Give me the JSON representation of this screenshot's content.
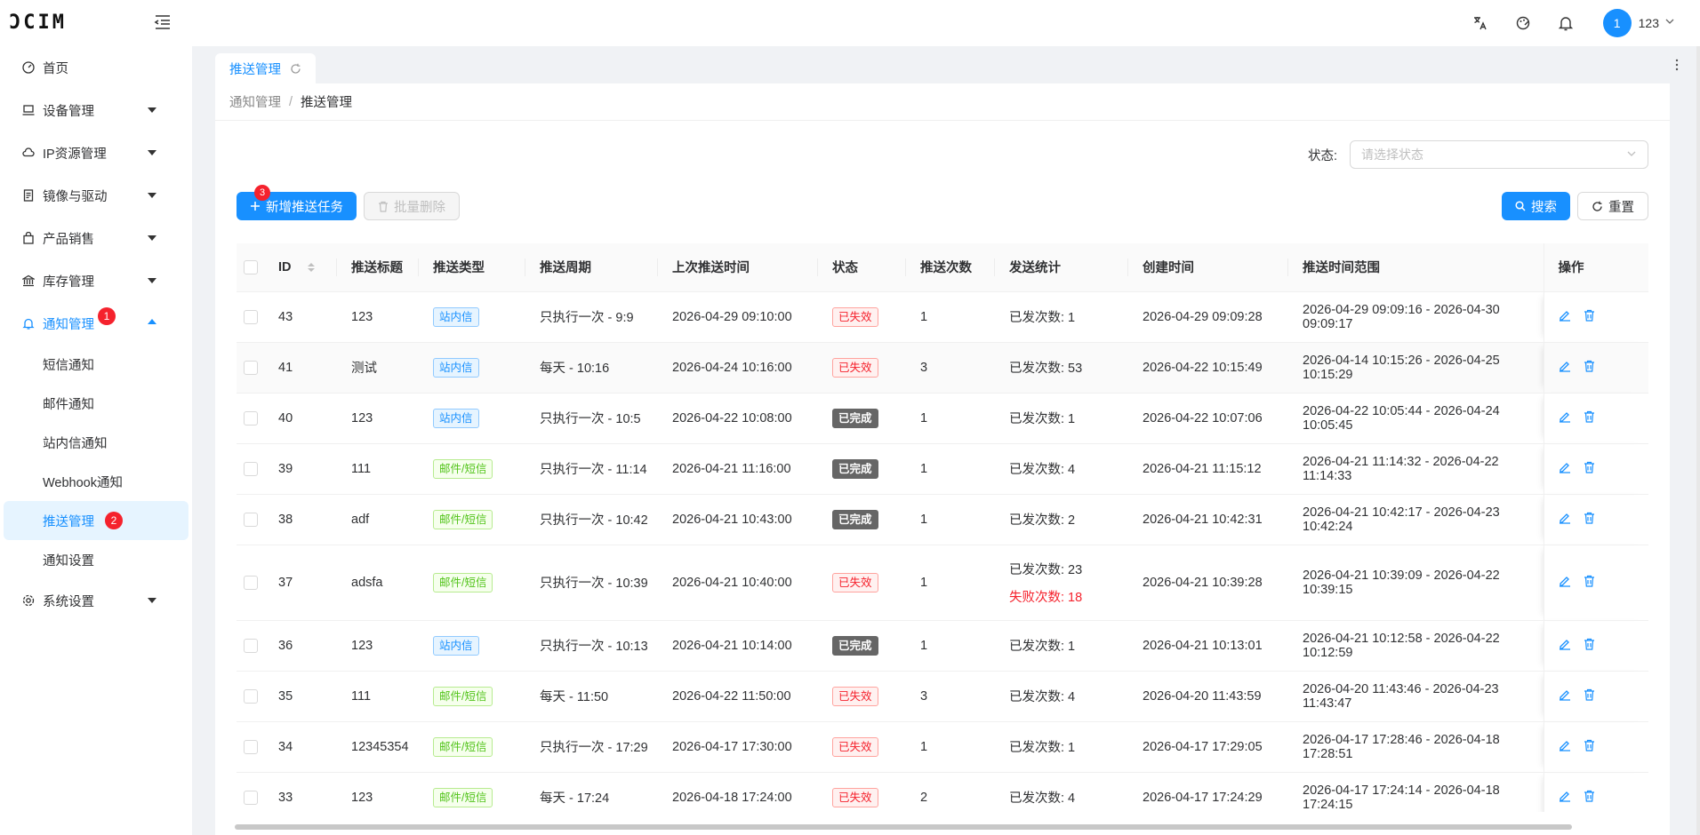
{
  "header": {
    "logo": "ƆCIM",
    "username": "123",
    "avatar_text": "1"
  },
  "sidebar": {
    "items": [
      {
        "label": "首页"
      },
      {
        "label": "设备管理"
      },
      {
        "label": "IP资源管理"
      },
      {
        "label": "镜像与驱动"
      },
      {
        "label": "产品销售"
      },
      {
        "label": "库存管理"
      },
      {
        "label": "通知管理",
        "badge": "1"
      },
      {
        "label": "系统设置"
      }
    ],
    "sub_items": [
      {
        "label": "短信通知"
      },
      {
        "label": "邮件通知"
      },
      {
        "label": "站内信通知"
      },
      {
        "label": "Webhook通知"
      },
      {
        "label": "推送管理",
        "badge": "2"
      },
      {
        "label": "通知设置"
      }
    ]
  },
  "tabs": [
    {
      "label": "推送管理"
    }
  ],
  "breadcrumb": {
    "parent": "通知管理",
    "separator": "/",
    "current": "推送管理"
  },
  "filter": {
    "label": "状态:",
    "placeholder": "请选择状态"
  },
  "toolbar": {
    "add_label": "新增推送任务",
    "add_badge": "3",
    "batch_delete_label": "批量删除",
    "search_label": "搜索",
    "reset_label": "重置"
  },
  "table": {
    "headers": [
      "ID",
      "推送标题",
      "推送类型",
      "推送周期",
      "上次推送时间",
      "状态",
      "推送次数",
      "发送统计",
      "创建时间",
      "推送时间范围",
      "操作"
    ],
    "rows": [
      {
        "id": "43",
        "title": "123",
        "type": "站内信",
        "type_color": "blue",
        "cycle": "只执行一次 - 9:9",
        "last": "2026-04-29 09:10:00",
        "status": "已失效",
        "status_color": "red",
        "count": "1",
        "sent": "已发次数: 1",
        "failed": "",
        "created": "2026-04-29 09:09:28",
        "range": "2026-04-29 09:09:16 - 2026-04-30 09:09:17"
      },
      {
        "id": "41",
        "title": "测试",
        "type": "站内信",
        "type_color": "blue",
        "cycle": "每天 - 10:16",
        "last": "2026-04-24 10:16:00",
        "status": "已失效",
        "status_color": "red",
        "count": "3",
        "sent": "已发次数: 53",
        "failed": "",
        "created": "2026-04-22 10:15:49",
        "range": "2026-04-14 10:15:26 - 2026-04-25 10:15:29"
      },
      {
        "id": "40",
        "title": "123",
        "type": "站内信",
        "type_color": "blue",
        "cycle": "只执行一次 - 10:5",
        "last": "2026-04-22 10:08:00",
        "status": "已完成",
        "status_color": "grey",
        "count": "1",
        "sent": "已发次数: 1",
        "failed": "",
        "created": "2026-04-22 10:07:06",
        "range": "2026-04-22 10:05:44 - 2026-04-24 10:05:45"
      },
      {
        "id": "39",
        "title": "111",
        "type": "邮件/短信",
        "type_color": "green",
        "cycle": "只执行一次 - 11:14",
        "last": "2026-04-21 11:16:00",
        "status": "已完成",
        "status_color": "grey",
        "count": "1",
        "sent": "已发次数: 4",
        "failed": "",
        "created": "2026-04-21 11:15:12",
        "range": "2026-04-21 11:14:32 - 2026-04-22 11:14:33"
      },
      {
        "id": "38",
        "title": "adf",
        "type": "邮件/短信",
        "type_color": "green",
        "cycle": "只执行一次 - 10:42",
        "last": "2026-04-21 10:43:00",
        "status": "已完成",
        "status_color": "grey",
        "count": "1",
        "sent": "已发次数: 2",
        "failed": "",
        "created": "2026-04-21 10:42:31",
        "range": "2026-04-21 10:42:17 - 2026-04-23 10:42:24"
      },
      {
        "id": "37",
        "title": "adsfa",
        "type": "邮件/短信",
        "type_color": "green",
        "cycle": "只执行一次 - 10:39",
        "last": "2026-04-21 10:40:00",
        "status": "已失效",
        "status_color": "red",
        "count": "1",
        "sent": "已发次数: 23",
        "failed": "失败次数: 18",
        "created": "2026-04-21 10:39:28",
        "range": "2026-04-21 10:39:09 - 2026-04-22 10:39:15"
      },
      {
        "id": "36",
        "title": "123",
        "type": "站内信",
        "type_color": "blue",
        "cycle": "只执行一次 - 10:13",
        "last": "2026-04-21 10:14:00",
        "status": "已完成",
        "status_color": "grey",
        "count": "1",
        "sent": "已发次数: 1",
        "failed": "",
        "created": "2026-04-21 10:13:01",
        "range": "2026-04-21 10:12:58 - 2026-04-22 10:12:59"
      },
      {
        "id": "35",
        "title": "111",
        "type": "邮件/短信",
        "type_color": "green",
        "cycle": "每天 - 11:50",
        "last": "2026-04-22 11:50:00",
        "status": "已失效",
        "status_color": "red",
        "count": "3",
        "sent": "已发次数: 4",
        "failed": "",
        "created": "2026-04-20 11:43:59",
        "range": "2026-04-20 11:43:46 - 2026-04-23 11:43:47"
      },
      {
        "id": "34",
        "title": "12345354",
        "type": "邮件/短信",
        "type_color": "green",
        "cycle": "只执行一次 - 17:29",
        "last": "2026-04-17 17:30:00",
        "status": "已失效",
        "status_color": "red",
        "count": "1",
        "sent": "已发次数: 1",
        "failed": "",
        "created": "2026-04-17 17:29:05",
        "range": "2026-04-17 17:28:46 - 2026-04-18 17:28:51"
      },
      {
        "id": "33",
        "title": "123",
        "type": "邮件/短信",
        "type_color": "green",
        "cycle": "每天 - 17:24",
        "last": "2026-04-18 17:24:00",
        "status": "已失效",
        "status_color": "red",
        "count": "2",
        "sent": "已发次数: 4",
        "failed": "",
        "created": "2026-04-17 17:24:29",
        "range": "2026-04-17 17:24:14 - 2026-04-18 17:24:15"
      }
    ]
  }
}
